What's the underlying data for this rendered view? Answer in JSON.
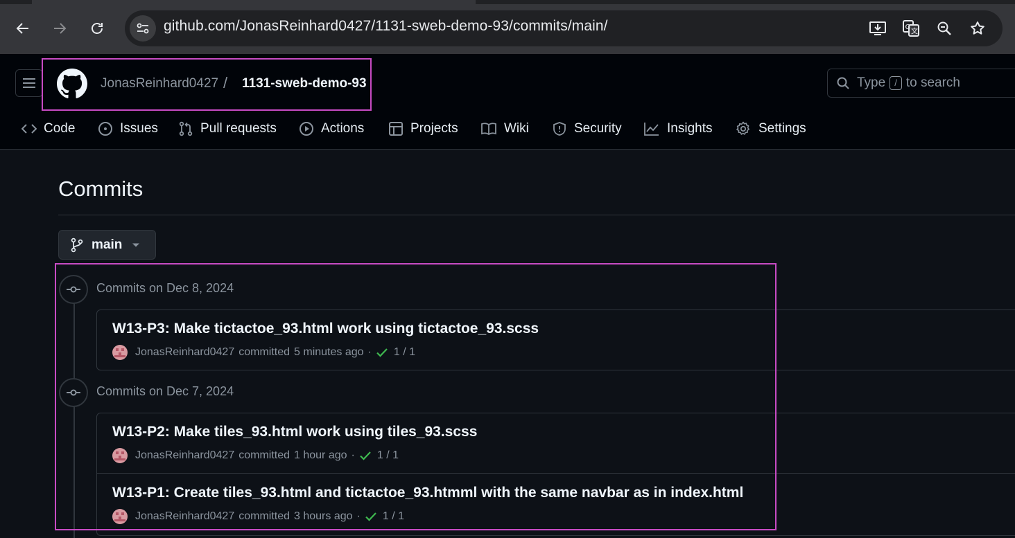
{
  "browser": {
    "url": "github.com/JonasReinhard0427/1131-sweb-demo-93/commits/main/",
    "icons": [
      "back-icon",
      "forward-icon",
      "reload-icon",
      "site-info-icon",
      "install-icon",
      "translate-icon",
      "zoom-icon",
      "bookmark-star-icon"
    ]
  },
  "header": {
    "owner": "JonasReinhard0427",
    "separator": "/",
    "repo": "1131-sweb-demo-93",
    "search": {
      "prefix": "Type",
      "key": "/",
      "suffix": "to search"
    }
  },
  "repo_nav": [
    {
      "label": "Code",
      "icon": "code-icon"
    },
    {
      "label": "Issues",
      "icon": "issue-icon"
    },
    {
      "label": "Pull requests",
      "icon": "pull-request-icon"
    },
    {
      "label": "Actions",
      "icon": "play-icon"
    },
    {
      "label": "Projects",
      "icon": "table-icon"
    },
    {
      "label": "Wiki",
      "icon": "book-icon"
    },
    {
      "label": "Security",
      "icon": "shield-icon"
    },
    {
      "label": "Insights",
      "icon": "graph-icon"
    },
    {
      "label": "Settings",
      "icon": "gear-icon"
    }
  ],
  "page": {
    "title": "Commits",
    "branch": "main"
  },
  "commit_groups": [
    {
      "date_label": "Commits on Dec 8, 2024",
      "commits": [
        {
          "message": "W13-P3: Make tictactoe_93.html work using tictactoe_93.scss",
          "author": "JonasReinhard0427",
          "action": "committed",
          "time": "5 minutes ago",
          "checks": "1 / 1"
        }
      ]
    },
    {
      "date_label": "Commits on Dec 7, 2024",
      "commits": [
        {
          "message": "W13-P2: Make tiles_93.html work using tiles_93.scss",
          "author": "JonasReinhard0427",
          "action": "committed",
          "time": "1 hour ago",
          "checks": "1 / 1"
        },
        {
          "message": "W13-P1: Create tiles_93.html and tictactoe_93.htmml with the same navbar as in index.html",
          "author": "JonasReinhard0427",
          "action": "committed",
          "time": "3 hours ago",
          "checks": "1 / 1"
        }
      ]
    }
  ],
  "colors": {
    "highlight": "#c74bc4",
    "success": "#3fb950",
    "background": "#0d1117"
  }
}
